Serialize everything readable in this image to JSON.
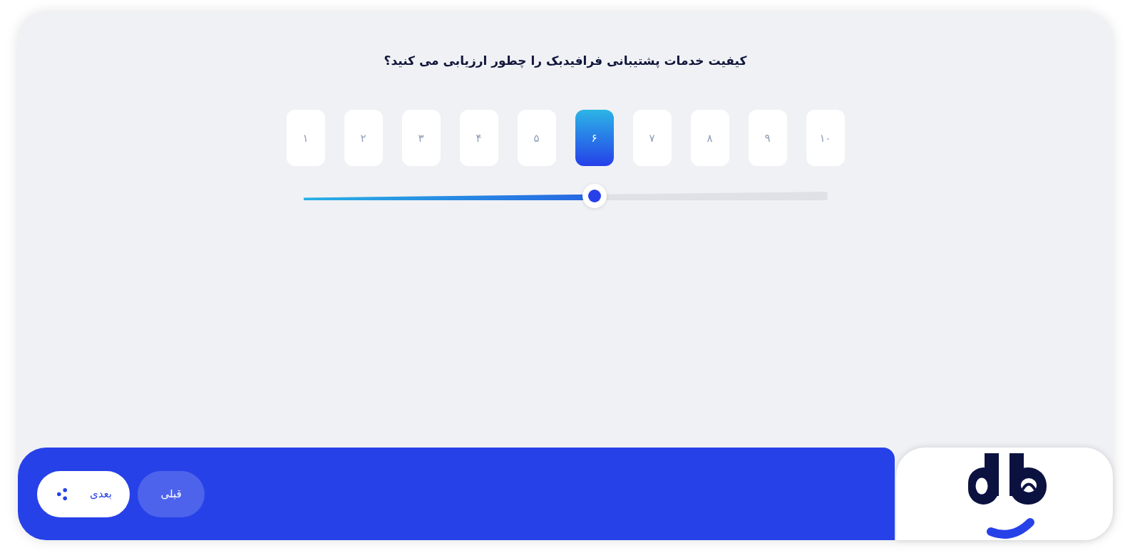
{
  "question": {
    "title": "کیفیت خدمات پشتیبانی فرافیدبک را چطور ارزیابی می کنید؟"
  },
  "rating": {
    "options": [
      {
        "label": "۱۰",
        "selected": false
      },
      {
        "label": "۹",
        "selected": false
      },
      {
        "label": "۸",
        "selected": false
      },
      {
        "label": "۷",
        "selected": false
      },
      {
        "label": "۶",
        "selected": true
      },
      {
        "label": "۵",
        "selected": false
      },
      {
        "label": "۴",
        "selected": false
      },
      {
        "label": "۳",
        "selected": false
      },
      {
        "label": "۲",
        "selected": false
      },
      {
        "label": "۱",
        "selected": false
      }
    ],
    "slider": {
      "level": 0.556
    }
  },
  "navigation": {
    "buttons": [
      {
        "label": "قبلی",
        "kind": "secondary"
      },
      {
        "label": "بعدی",
        "kind": "primary"
      }
    ]
  }
}
